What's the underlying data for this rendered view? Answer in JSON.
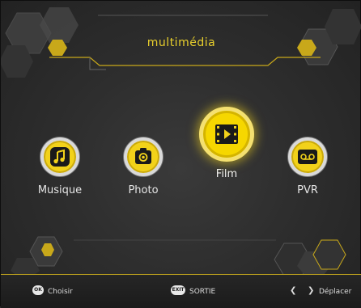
{
  "header": {
    "title": "multimédia"
  },
  "menu": {
    "items": [
      {
        "label": "Musique",
        "icon": "music-note-icon"
      },
      {
        "label": "Photo",
        "icon": "camera-icon"
      },
      {
        "label": "Film",
        "icon": "film-play-icon",
        "selected": true
      },
      {
        "label": "PVR",
        "icon": "tape-recorder-icon"
      }
    ]
  },
  "footer": {
    "ok_key": "OK",
    "ok_label": "Choisir",
    "exit_key": "EXIT",
    "exit_label": "SORTIE",
    "left_arrow": "❮",
    "right_arrow": "❯",
    "move_label": "Déplacer"
  },
  "colors": {
    "accent": "#f2d21a",
    "background": "#2b2b2b",
    "text": "#e6e6e6"
  }
}
